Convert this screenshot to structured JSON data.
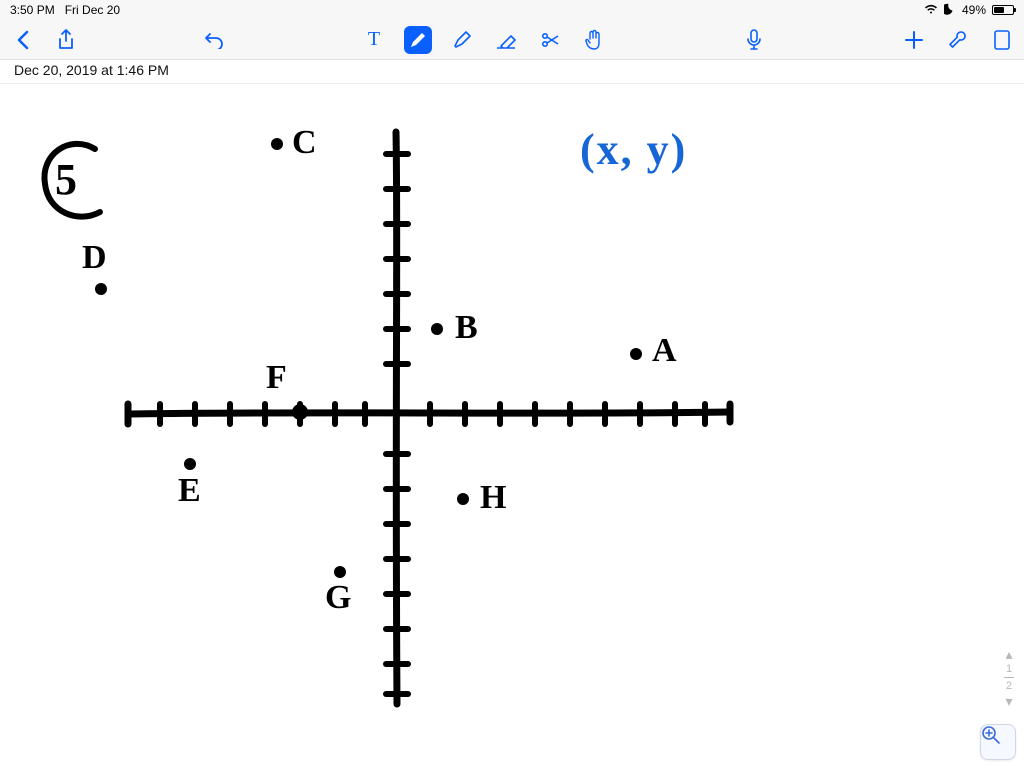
{
  "status": {
    "time": "3:50 PM",
    "date": "Fri Dec 20",
    "battery_percent": "49%"
  },
  "note": {
    "timestamp": "Dec 20, 2019 at 1:46 PM"
  },
  "handwriting": {
    "problem_number": "5",
    "xy_label": "(x, y)",
    "points": {
      "A": "A",
      "B": "B",
      "C": "C",
      "D": "D",
      "E": "E",
      "F": "F",
      "G": "G",
      "H": "H"
    }
  },
  "toolbar": {
    "back": "back",
    "share": "share",
    "undo": "undo",
    "text_tool": "T",
    "pen": "pen",
    "highlighter": "highlighter",
    "eraser": "eraser",
    "scissors": "scissors",
    "lasso": "lasso-hand",
    "mic": "microphone",
    "add": "add",
    "wrench": "settings",
    "page": "page"
  },
  "zoom": {
    "label": "zoom-in"
  },
  "scroll_hint": {
    "up": "▴",
    "fraction_top": "1",
    "fraction_bottom": "2",
    "down": "▾"
  },
  "chart_data": {
    "type": "scatter",
    "title": "",
    "xy_annotation": "(x, y)",
    "problem_number": 5,
    "xlabel": "",
    "ylabel": "",
    "xlim": [
      -8,
      8
    ],
    "ylim": [
      -8,
      8
    ],
    "x_ticks": [
      -8,
      -7,
      -6,
      -5,
      -4,
      -3,
      -2,
      -1,
      0,
      1,
      2,
      3,
      4,
      5,
      6,
      7,
      8
    ],
    "y_ticks": [
      -8,
      -7,
      -6,
      -5,
      -4,
      -3,
      -2,
      -1,
      0,
      1,
      2,
      3,
      4,
      5,
      6,
      7,
      8
    ],
    "points": [
      {
        "label": "A",
        "x": 6,
        "y": 1
      },
      {
        "label": "B",
        "x": 1,
        "y": 2
      },
      {
        "label": "C",
        "x": -3,
        "y": 7
      },
      {
        "label": "D",
        "x": -8,
        "y": 3
      },
      {
        "label": "E",
        "x": -6,
        "y": -1
      },
      {
        "label": "F",
        "x": -3,
        "y": 0
      },
      {
        "label": "G",
        "x": -1,
        "y": -4
      },
      {
        "label": "H",
        "x": 2,
        "y": -2
      }
    ]
  }
}
